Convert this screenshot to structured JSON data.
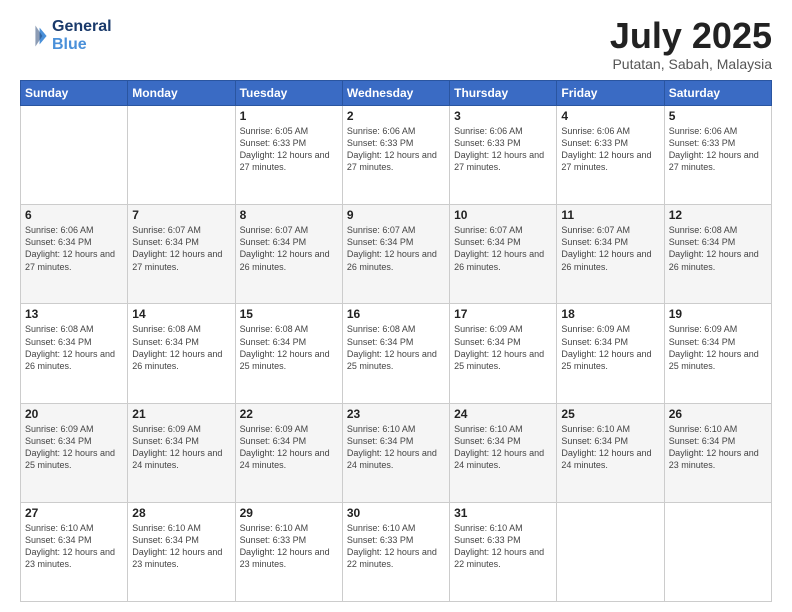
{
  "header": {
    "logo_line1": "General",
    "logo_line2": "Blue",
    "month": "July 2025",
    "location": "Putatan, Sabah, Malaysia"
  },
  "days_of_week": [
    "Sunday",
    "Monday",
    "Tuesday",
    "Wednesday",
    "Thursday",
    "Friday",
    "Saturday"
  ],
  "weeks": [
    [
      {
        "day": "",
        "empty": true
      },
      {
        "day": "",
        "empty": true
      },
      {
        "day": "1",
        "sunrise": "6:05 AM",
        "sunset": "6:33 PM",
        "daylight": "12 hours and 27 minutes."
      },
      {
        "day": "2",
        "sunrise": "6:06 AM",
        "sunset": "6:33 PM",
        "daylight": "12 hours and 27 minutes."
      },
      {
        "day": "3",
        "sunrise": "6:06 AM",
        "sunset": "6:33 PM",
        "daylight": "12 hours and 27 minutes."
      },
      {
        "day": "4",
        "sunrise": "6:06 AM",
        "sunset": "6:33 PM",
        "daylight": "12 hours and 27 minutes."
      },
      {
        "day": "5",
        "sunrise": "6:06 AM",
        "sunset": "6:33 PM",
        "daylight": "12 hours and 27 minutes."
      }
    ],
    [
      {
        "day": "6",
        "sunrise": "6:06 AM",
        "sunset": "6:34 PM",
        "daylight": "12 hours and 27 minutes."
      },
      {
        "day": "7",
        "sunrise": "6:07 AM",
        "sunset": "6:34 PM",
        "daylight": "12 hours and 27 minutes."
      },
      {
        "day": "8",
        "sunrise": "6:07 AM",
        "sunset": "6:34 PM",
        "daylight": "12 hours and 26 minutes."
      },
      {
        "day": "9",
        "sunrise": "6:07 AM",
        "sunset": "6:34 PM",
        "daylight": "12 hours and 26 minutes."
      },
      {
        "day": "10",
        "sunrise": "6:07 AM",
        "sunset": "6:34 PM",
        "daylight": "12 hours and 26 minutes."
      },
      {
        "day": "11",
        "sunrise": "6:07 AM",
        "sunset": "6:34 PM",
        "daylight": "12 hours and 26 minutes."
      },
      {
        "day": "12",
        "sunrise": "6:08 AM",
        "sunset": "6:34 PM",
        "daylight": "12 hours and 26 minutes."
      }
    ],
    [
      {
        "day": "13",
        "sunrise": "6:08 AM",
        "sunset": "6:34 PM",
        "daylight": "12 hours and 26 minutes."
      },
      {
        "day": "14",
        "sunrise": "6:08 AM",
        "sunset": "6:34 PM",
        "daylight": "12 hours and 26 minutes."
      },
      {
        "day": "15",
        "sunrise": "6:08 AM",
        "sunset": "6:34 PM",
        "daylight": "12 hours and 25 minutes."
      },
      {
        "day": "16",
        "sunrise": "6:08 AM",
        "sunset": "6:34 PM",
        "daylight": "12 hours and 25 minutes."
      },
      {
        "day": "17",
        "sunrise": "6:09 AM",
        "sunset": "6:34 PM",
        "daylight": "12 hours and 25 minutes."
      },
      {
        "day": "18",
        "sunrise": "6:09 AM",
        "sunset": "6:34 PM",
        "daylight": "12 hours and 25 minutes."
      },
      {
        "day": "19",
        "sunrise": "6:09 AM",
        "sunset": "6:34 PM",
        "daylight": "12 hours and 25 minutes."
      }
    ],
    [
      {
        "day": "20",
        "sunrise": "6:09 AM",
        "sunset": "6:34 PM",
        "daylight": "12 hours and 25 minutes."
      },
      {
        "day": "21",
        "sunrise": "6:09 AM",
        "sunset": "6:34 PM",
        "daylight": "12 hours and 24 minutes."
      },
      {
        "day": "22",
        "sunrise": "6:09 AM",
        "sunset": "6:34 PM",
        "daylight": "12 hours and 24 minutes."
      },
      {
        "day": "23",
        "sunrise": "6:10 AM",
        "sunset": "6:34 PM",
        "daylight": "12 hours and 24 minutes."
      },
      {
        "day": "24",
        "sunrise": "6:10 AM",
        "sunset": "6:34 PM",
        "daylight": "12 hours and 24 minutes."
      },
      {
        "day": "25",
        "sunrise": "6:10 AM",
        "sunset": "6:34 PM",
        "daylight": "12 hours and 24 minutes."
      },
      {
        "day": "26",
        "sunrise": "6:10 AM",
        "sunset": "6:34 PM",
        "daylight": "12 hours and 23 minutes."
      }
    ],
    [
      {
        "day": "27",
        "sunrise": "6:10 AM",
        "sunset": "6:34 PM",
        "daylight": "12 hours and 23 minutes."
      },
      {
        "day": "28",
        "sunrise": "6:10 AM",
        "sunset": "6:34 PM",
        "daylight": "12 hours and 23 minutes."
      },
      {
        "day": "29",
        "sunrise": "6:10 AM",
        "sunset": "6:33 PM",
        "daylight": "12 hours and 23 minutes."
      },
      {
        "day": "30",
        "sunrise": "6:10 AM",
        "sunset": "6:33 PM",
        "daylight": "12 hours and 22 minutes."
      },
      {
        "day": "31",
        "sunrise": "6:10 AM",
        "sunset": "6:33 PM",
        "daylight": "12 hours and 22 minutes."
      },
      {
        "day": "",
        "empty": true
      },
      {
        "day": "",
        "empty": true
      }
    ]
  ]
}
